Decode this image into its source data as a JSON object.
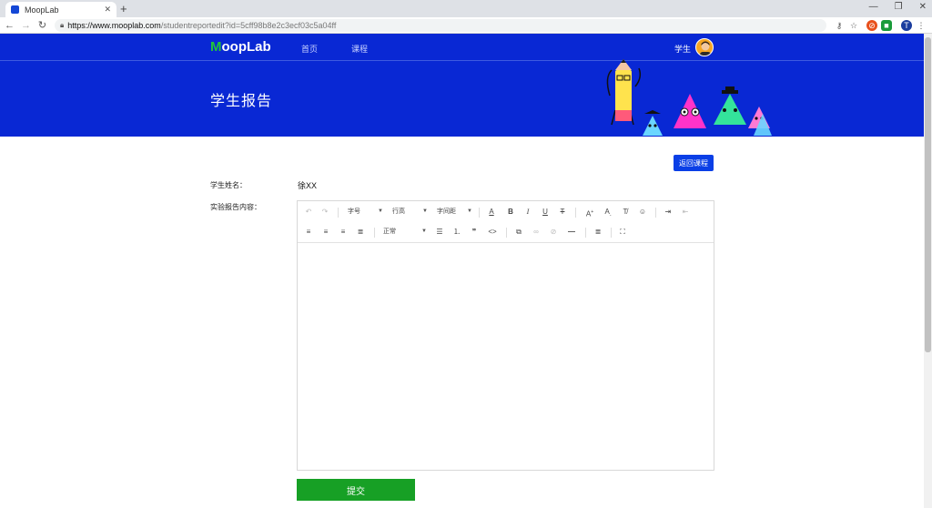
{
  "browser": {
    "tab_title": "MoopLab",
    "url_host": "https://www.mooplab.com",
    "url_path": "/studentreportedit?id=5cff98b8e2c3ecf03c5a04ff"
  },
  "header": {
    "logo_first": "M",
    "logo_rest": "oopLab",
    "nav": [
      "首页",
      "课程"
    ],
    "username": "学生"
  },
  "banner": {
    "title": "学生报告"
  },
  "actions": {
    "back_label": "返回课程",
    "submit_label": "提交"
  },
  "form": {
    "name_label": "学生姓名：",
    "name_value": "徐XX",
    "content_label": "实验报告内容："
  },
  "editor": {
    "fontsize": "字号",
    "lineheight": "行高",
    "letterspacing": "字间距",
    "paragraph": "正常"
  },
  "colors": {
    "brand": "#0928d4",
    "submit": "#17a025",
    "logo_accent": "#22c33a"
  }
}
